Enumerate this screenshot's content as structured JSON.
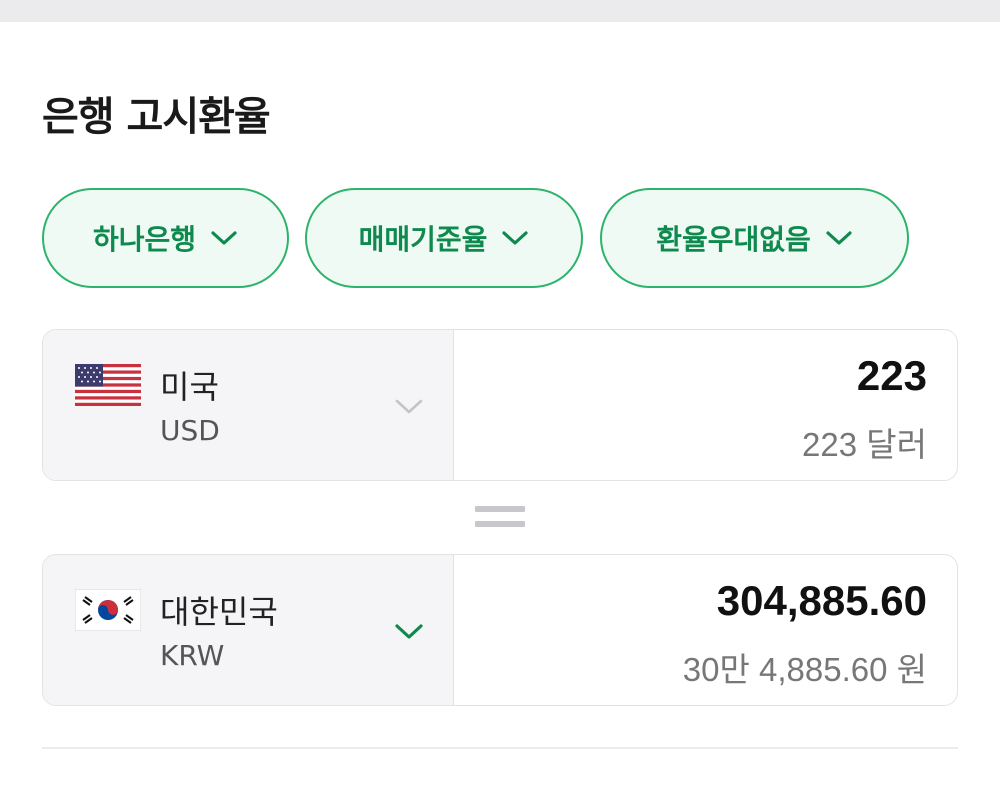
{
  "title": "은행 고시환율",
  "filters": [
    {
      "label": "하나은행"
    },
    {
      "label": "매매기준율"
    },
    {
      "label": "환율우대없음"
    }
  ],
  "from": {
    "flag": "us-flag-icon",
    "name": "미국",
    "code": "USD",
    "amount": "223",
    "amount_text": "223 달러"
  },
  "to": {
    "flag": "kr-flag-icon",
    "name": "대한민국",
    "code": "KRW",
    "amount": "304,885.60",
    "amount_text": "30만 4,885.60 원"
  },
  "colors": {
    "accent": "#0e8a4e",
    "chip_border": "#2db36b",
    "chip_bg": "#eefaf3"
  }
}
